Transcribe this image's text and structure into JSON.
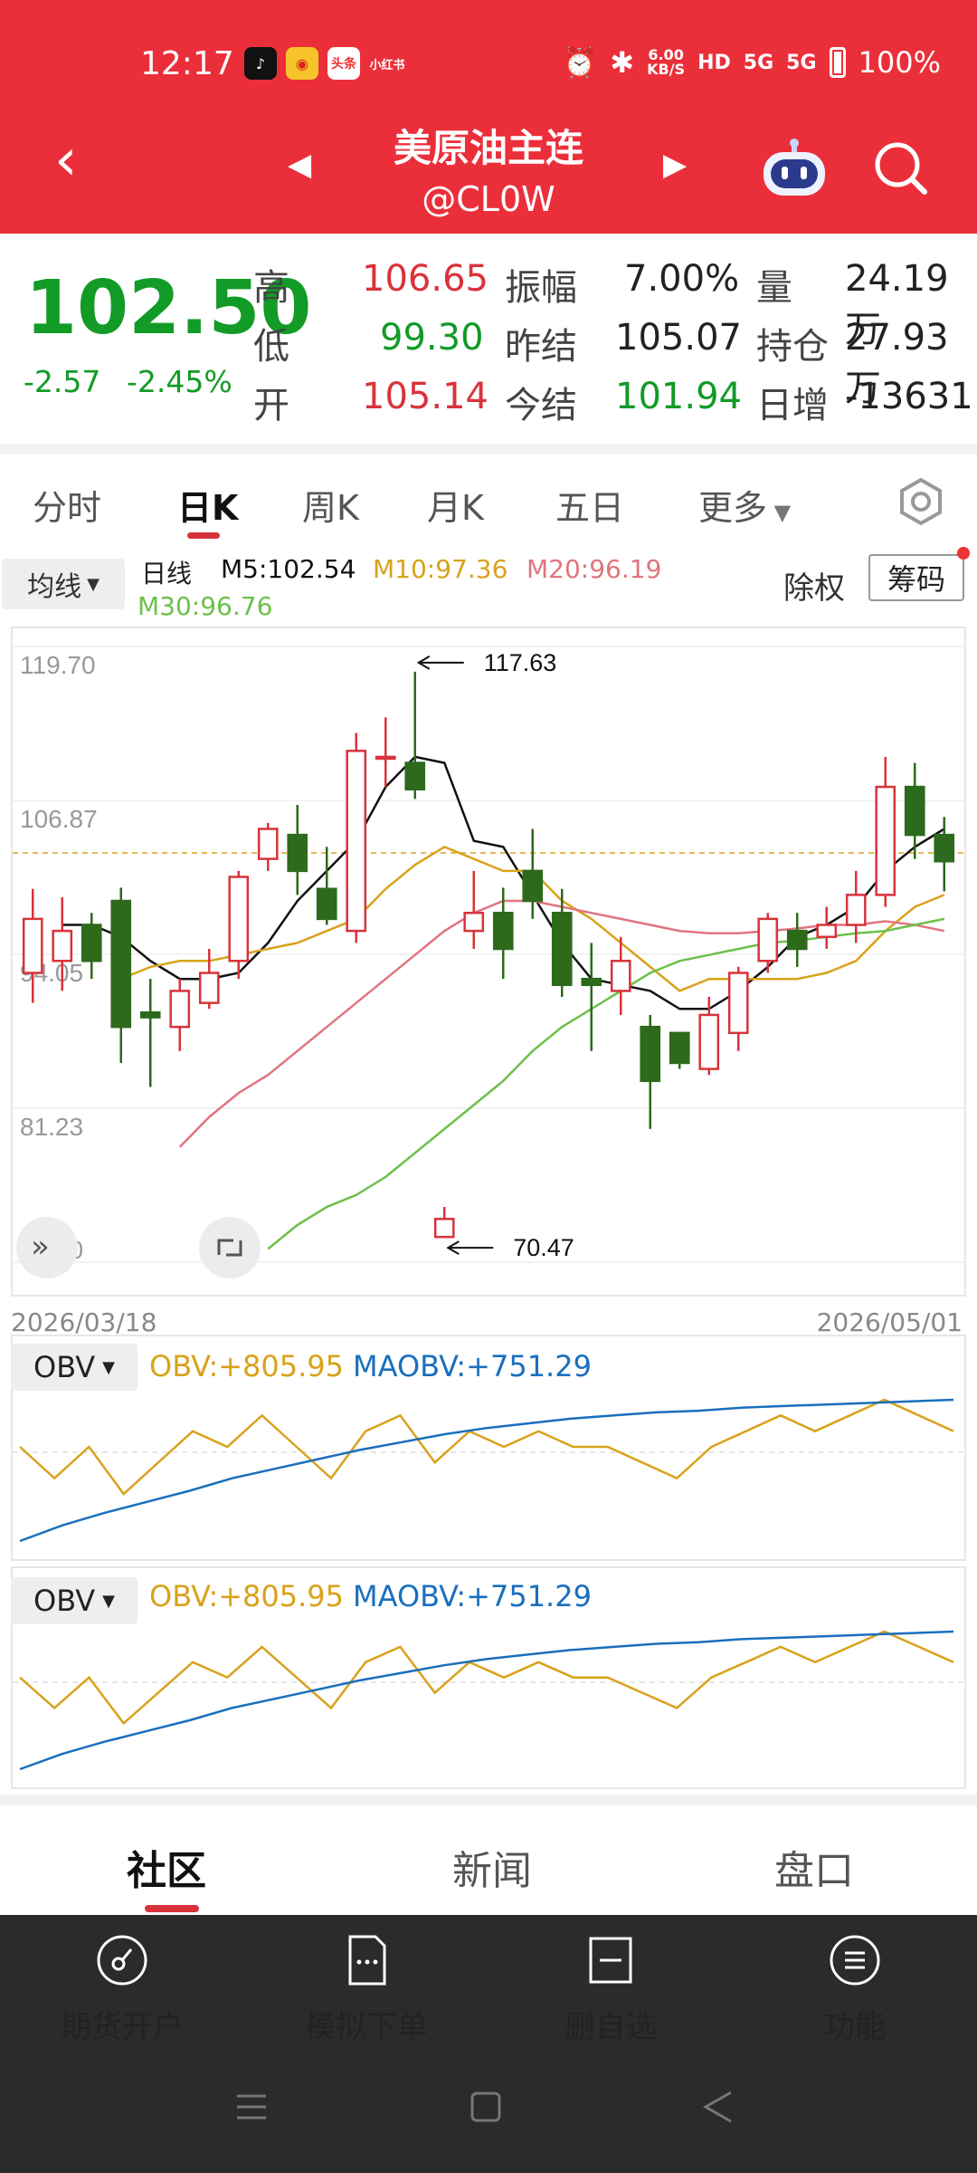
{
  "status_bar": {
    "time": "12:17",
    "app_icons": [
      "tiktok-icon",
      "weibo-icon",
      "toutiao-icon",
      "xiaohongshu-icon"
    ],
    "toutiao_label": "头条",
    "xhs_label": "小红书",
    "net_speed_value": "6.00",
    "net_speed_unit": "KB/S",
    "hd_label": "HD",
    "signal_1": "5G",
    "signal_2": "5G",
    "battery": "100%"
  },
  "header": {
    "title": "美原油主连",
    "subtitle": "@CL0W"
  },
  "quote": {
    "price": "102.50",
    "change": "-2.57",
    "change_pct": "-2.45%",
    "high_label": "高",
    "high": "106.65",
    "low_label": "低",
    "low": "99.30",
    "open_label": "开",
    "open": "105.14",
    "amplitude_label": "振幅",
    "amplitude": "7.00%",
    "prev_settle_label": "昨结",
    "prev_settle": "105.07",
    "settle_label": "今结",
    "settle": "101.94",
    "volume_label": "量",
    "volume": "24.19万",
    "oi_label": "持仓",
    "oi": "27.93万",
    "daily_inc_label": "日增",
    "daily_inc": "-13631"
  },
  "tabs": [
    "分时",
    "日K",
    "周K",
    "月K",
    "五日",
    "更多"
  ],
  "active_tab": "日K",
  "ma_bar": {
    "selector": "均线",
    "period": "日线",
    "m5": "M5:102.54",
    "m10": "M10:97.36",
    "m20": "M20:96.19",
    "m30": "M30:96.76",
    "chuquan": "除权",
    "chouma": "筹码"
  },
  "colors": {
    "brand_red": "#eb2f3a",
    "up": "#d8333a",
    "down": "#2d6a1c",
    "m5": "#111111",
    "m10": "#d9a21b",
    "m20": "#e07480",
    "m30": "#6cc04a",
    "obv": "#d9a21b",
    "maobv": "#1a6fbd"
  },
  "chart_data": [
    {
      "type": "candlestick",
      "y_ticks": [
        "119.70",
        "106.87",
        "94.05",
        "81.23",
        "68.40"
      ],
      "ylim": [
        68.4,
        119.7
      ],
      "x_start": "2026/03/18",
      "x_end": "2026/05/01",
      "annotations": [
        {
          "label": "117.63"
        },
        {
          "label": "70.47"
        }
      ],
      "candles": [
        {
          "o": 92.5,
          "h": 99.5,
          "l": 90.0,
          "c": 97.0
        },
        {
          "o": 93.5,
          "h": 98.8,
          "l": 91.0,
          "c": 96.0
        },
        {
          "o": 96.5,
          "h": 97.5,
          "l": 92.0,
          "c": 93.5
        },
        {
          "o": 98.5,
          "h": 99.6,
          "l": 85.0,
          "c": 88.0
        },
        {
          "o": 89.2,
          "h": 92.0,
          "l": 83.0,
          "c": 88.8
        },
        {
          "o": 88.0,
          "h": 92.0,
          "l": 86.0,
          "c": 91.0
        },
        {
          "o": 90.0,
          "h": 94.5,
          "l": 89.5,
          "c": 92.5
        },
        {
          "o": 93.5,
          "h": 101.0,
          "l": 92.0,
          "c": 100.5
        },
        {
          "o": 102.0,
          "h": 105.0,
          "l": 101.0,
          "c": 104.5
        },
        {
          "o": 104.0,
          "h": 106.5,
          "l": 99.0,
          "c": 101.0
        },
        {
          "o": 99.5,
          "h": 103.0,
          "l": 96.5,
          "c": 97.0
        },
        {
          "o": 96.0,
          "h": 112.5,
          "l": 95.0,
          "c": 111.0
        },
        {
          "o": 110.5,
          "h": 113.8,
          "l": 108.0,
          "c": 110.5
        },
        {
          "o": 110.0,
          "h": 117.6,
          "l": 107.0,
          "c": 107.8
        },
        {
          "o": 70.5,
          "h": 73.0,
          "l": 70.5,
          "c": 72.0
        },
        {
          "o": 96.0,
          "h": 101.0,
          "l": 94.5,
          "c": 97.5
        },
        {
          "o": 97.5,
          "h": 99.6,
          "l": 92.0,
          "c": 94.5
        },
        {
          "o": 101.0,
          "h": 104.5,
          "l": 97.0,
          "c": 98.5
        },
        {
          "o": 97.5,
          "h": 99.5,
          "l": 90.5,
          "c": 91.5
        },
        {
          "o": 92.0,
          "h": 95.0,
          "l": 86.0,
          "c": 91.5
        },
        {
          "o": 91.0,
          "h": 95.5,
          "l": 89.0,
          "c": 93.5
        },
        {
          "o": 88.0,
          "h": 89.0,
          "l": 79.5,
          "c": 83.5
        },
        {
          "o": 87.5,
          "h": 87.5,
          "l": 84.5,
          "c": 85.0
        },
        {
          "o": 84.5,
          "h": 90.5,
          "l": 84.0,
          "c": 89.0
        },
        {
          "o": 87.5,
          "h": 93.0,
          "l": 86.0,
          "c": 92.5
        },
        {
          "o": 93.5,
          "h": 97.5,
          "l": 92.5,
          "c": 97.0
        },
        {
          "o": 96.0,
          "h": 97.5,
          "l": 93.0,
          "c": 94.5
        },
        {
          "o": 95.5,
          "h": 98.0,
          "l": 94.5,
          "c": 96.5
        },
        {
          "o": 96.5,
          "h": 101.0,
          "l": 95.0,
          "c": 99.0
        },
        {
          "o": 99.0,
          "h": 110.5,
          "l": 98.0,
          "c": 108.0
        },
        {
          "o": 108.0,
          "h": 110.0,
          "l": 102.0,
          "c": 104.0
        },
        {
          "o": 104.0,
          "h": 105.5,
          "l": 99.3,
          "c": 101.8
        }
      ],
      "series": [
        {
          "name": "M5",
          "values": [
            96.5,
            96.5,
            95.5,
            93.5,
            92.0,
            92.0,
            92.5,
            95.0,
            98.5,
            101.0,
            103.5,
            108.0,
            110.5,
            110.0,
            103.5,
            103.0,
            99.0,
            95.0,
            92.0,
            91.5,
            91.0,
            89.5,
            89.5,
            91.0,
            93.0,
            95.5,
            96.5,
            98.0,
            101.0,
            103.0,
            104.5
          ]
        },
        {
          "name": "M10",
          "values": [
            92.0,
            93.0,
            93.5,
            93.5,
            94.0,
            94.5,
            95.0,
            96.0,
            97.0,
            99.5,
            101.5,
            103.0,
            102.0,
            101.0,
            101.0,
            98.5,
            97.0,
            95.0,
            93.0,
            91.0,
            92.0,
            92.0,
            92.0,
            92.0,
            92.5,
            93.5,
            96.0,
            98.0,
            99.0
          ]
        },
        {
          "name": "M20",
          "values": [
            78.0,
            80.5,
            82.5,
            84.0,
            86.0,
            88.0,
            90.0,
            92.0,
            94.0,
            96.0,
            97.5,
            98.5,
            98.5,
            98.0,
            97.5,
            97.0,
            96.5,
            96.0,
            95.8,
            95.8,
            96.0,
            96.2,
            96.5,
            96.5,
            96.8,
            96.5,
            96.0
          ]
        },
        {
          "name": "M30",
          "values": [
            69.5,
            71.5,
            73.0,
            74.0,
            75.5,
            77.5,
            79.5,
            81.5,
            83.5,
            86.0,
            88.0,
            89.5,
            91.0,
            92.5,
            93.5,
            94.0,
            94.5,
            95.0,
            95.2,
            95.5,
            95.8,
            96.0,
            96.5,
            97.0
          ]
        }
      ]
    },
    {
      "type": "line",
      "selector": "OBV",
      "legend": [
        "OBV:+805.95",
        "MAOBV:+751.29"
      ],
      "series": [
        {
          "name": "OBV",
          "values": [
            6,
            4,
            6,
            3,
            5,
            7,
            6,
            8,
            6,
            4,
            7,
            8,
            5,
            7,
            6,
            7,
            6,
            6,
            5,
            4,
            6,
            7,
            8,
            7,
            8,
            9,
            8,
            7
          ]
        },
        {
          "name": "MAOBV",
          "values": [
            0,
            1,
            1.8,
            2.5,
            3.2,
            4,
            4.6,
            5.2,
            5.8,
            6.3,
            6.8,
            7.2,
            7.5,
            7.8,
            8,
            8.2,
            8.3,
            8.5,
            8.6,
            8.7,
            8.8,
            8.9,
            9
          ]
        }
      ]
    },
    {
      "type": "line",
      "selector": "OBV",
      "legend": [
        "OBV:+805.95",
        "MAOBV:+751.29"
      ],
      "series": [
        {
          "name": "OBV",
          "values": [
            6,
            4,
            6,
            3,
            5,
            7,
            6,
            8,
            6,
            4,
            7,
            8,
            5,
            7,
            6,
            7,
            6,
            6,
            5,
            4,
            6,
            7,
            8,
            7,
            8,
            9,
            8,
            7
          ]
        },
        {
          "name": "MAOBV",
          "values": [
            0,
            1,
            1.8,
            2.5,
            3.2,
            4,
            4.6,
            5.2,
            5.8,
            6.3,
            6.8,
            7.2,
            7.5,
            7.8,
            8,
            8.2,
            8.3,
            8.5,
            8.6,
            8.7,
            8.8,
            8.9,
            9
          ]
        }
      ]
    }
  ],
  "bottom_tabs": [
    "社区",
    "新闻",
    "盘口"
  ],
  "bottom_nav": [
    "期货开户",
    "模拟下单",
    "删自选",
    "功能"
  ]
}
